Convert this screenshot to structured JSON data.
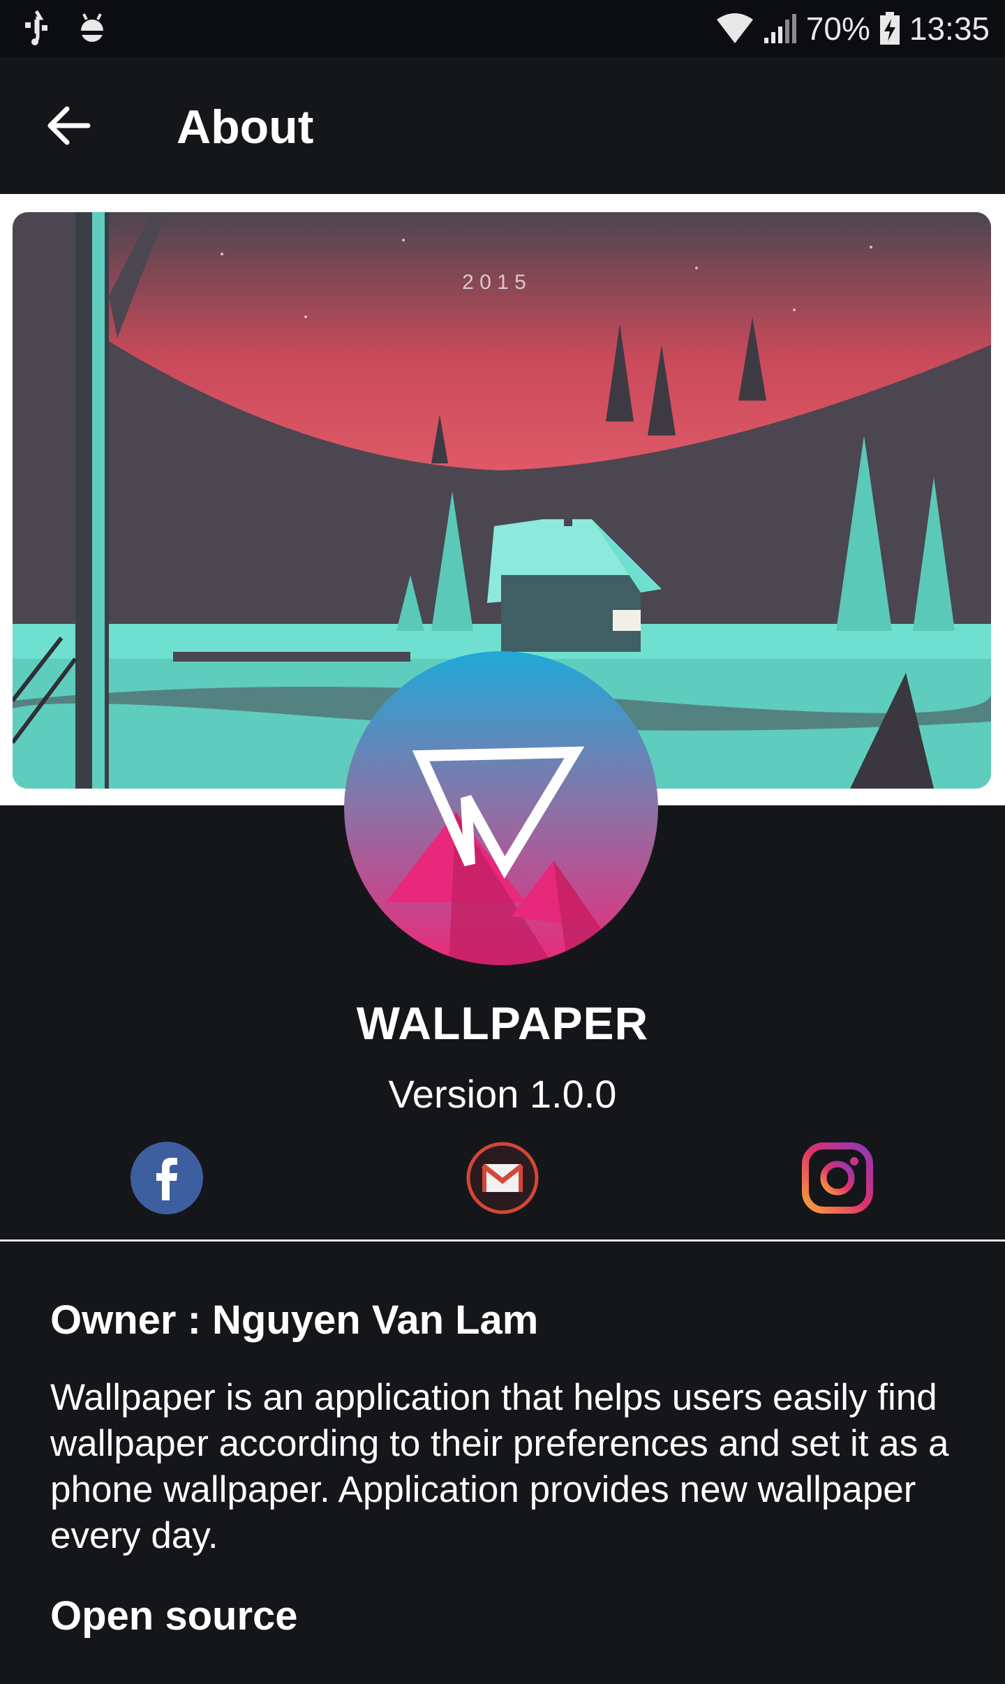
{
  "status_bar": {
    "battery": "70%",
    "time": "13:35",
    "icons": [
      "usb-icon",
      "android-debug-icon",
      "wifi-icon",
      "signal-icon",
      "battery-charging-icon"
    ]
  },
  "app_bar": {
    "title": "About",
    "back_icon": "arrow-back-icon"
  },
  "hero": {
    "year_text": "2 0 1 5",
    "colors": {
      "sky": "#c94a5a",
      "dark": "#4b4650",
      "teal": "#6fe0cf"
    }
  },
  "app": {
    "name": "WALLPAPER",
    "version": "Version 1.0.0"
  },
  "social": [
    {
      "name": "facebook",
      "icon": "facebook-icon",
      "color": "#3b5998"
    },
    {
      "name": "gmail",
      "icon": "gmail-icon",
      "color": "#d44638"
    },
    {
      "name": "instagram",
      "icon": "instagram-icon",
      "color": "#e1306c"
    }
  ],
  "about": {
    "owner": "Owner : Nguyen Van Lam",
    "description": "Wallpaper is an application that helps users easily find wallpaper according to their preferences and set it as a phone wallpaper. Application provides new wallpaper every day.",
    "open_source_heading": "Open source"
  }
}
